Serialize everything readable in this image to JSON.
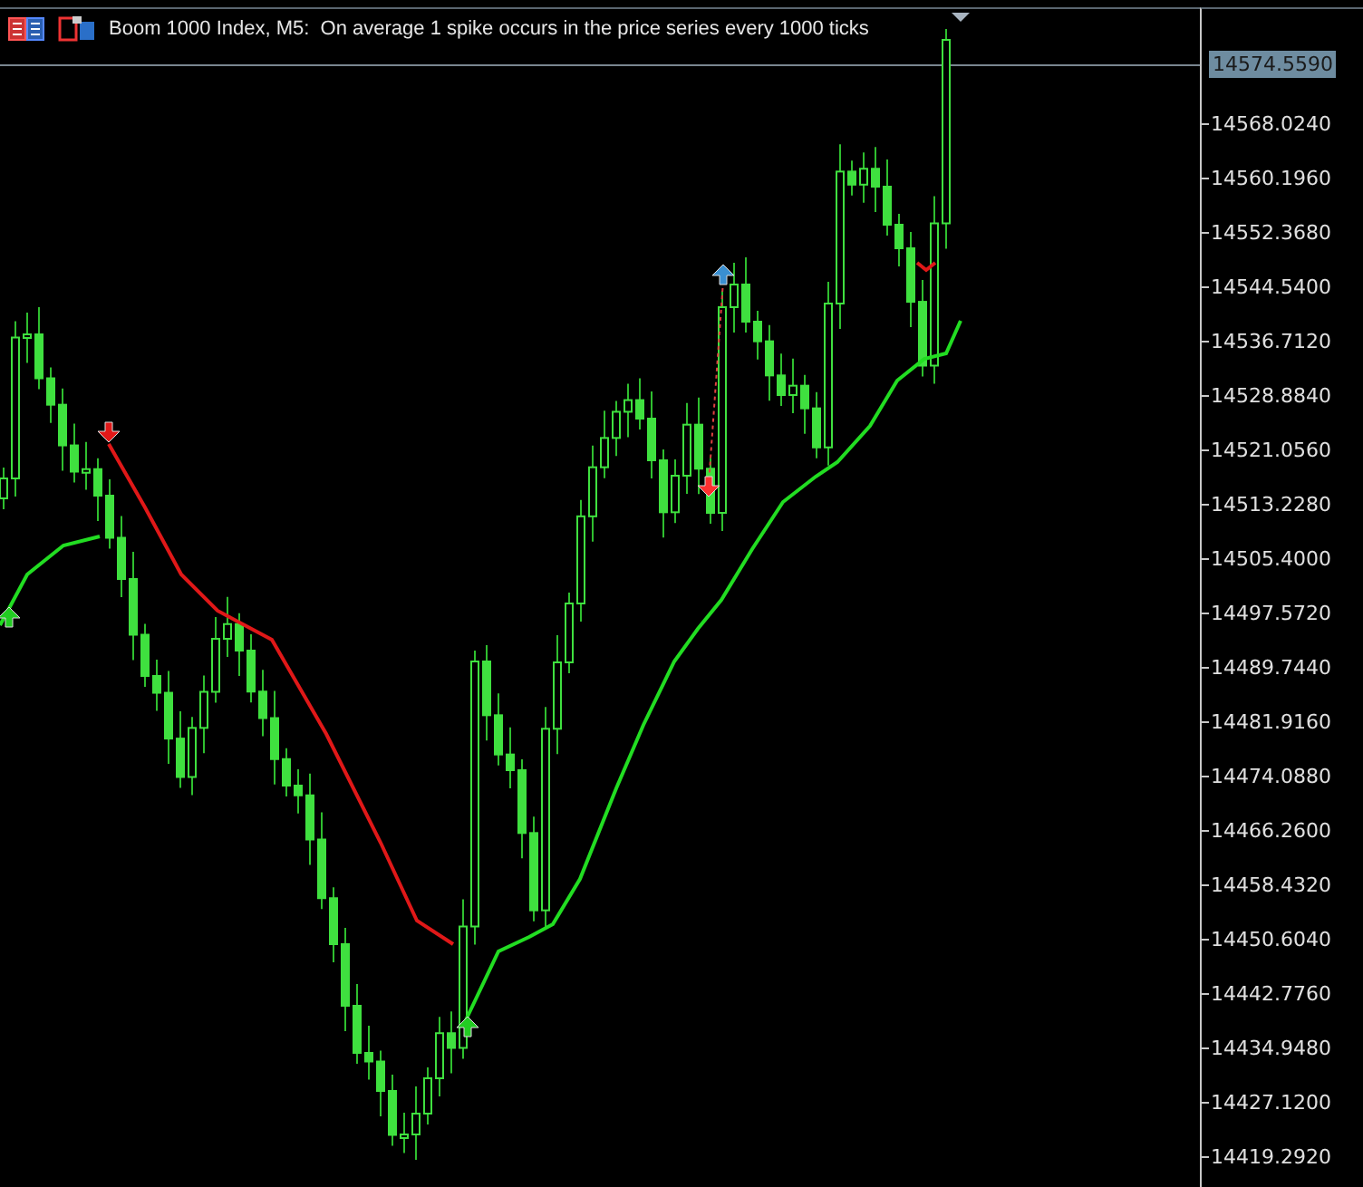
{
  "chart": {
    "title": "Boom 1000 Index, M5:  On average 1 spike occurs in the price series every 1000 ticks",
    "current_price": "14574.5590",
    "price_axis": [
      "14568.0240",
      "14560.1960",
      "14552.3680",
      "14544.5400",
      "14536.7120",
      "14528.8840",
      "14521.0560",
      "14513.2280",
      "14505.4000",
      "14497.5720",
      "14489.7440",
      "14481.9160",
      "14474.0880",
      "14466.2600",
      "14458.4320",
      "14450.6040",
      "14442.7760",
      "14434.9480",
      "14427.1200",
      "14419.2920"
    ]
  }
}
